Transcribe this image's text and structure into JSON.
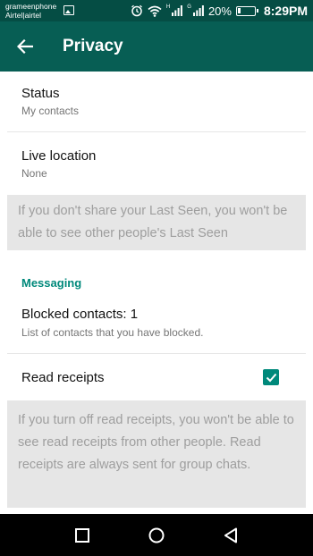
{
  "status_bar": {
    "carrier_1": "grameenphone",
    "carrier_2": "Airtel|airtel",
    "sim1_label": "H",
    "sim2_label": "G",
    "battery_percent": "20%",
    "battery_level": 0.2,
    "time": "8:29PM"
  },
  "app_bar": {
    "title": "Privacy"
  },
  "settings": {
    "status": {
      "title": "Status",
      "value": "My contacts"
    },
    "live_location": {
      "title": "Live location",
      "value": "None"
    },
    "last_seen_note": "If you don't share your Last Seen, you won't be able to see other people's Last Seen",
    "messaging_header": "Messaging",
    "blocked": {
      "title": "Blocked contacts: 1",
      "subtitle": "List of contacts that you have blocked."
    },
    "read_receipts": {
      "title": "Read receipts",
      "checked": true
    },
    "read_receipts_note": "If you turn off read receipts, you won't be able to see read receipts from other people. Read receipts are always sent for group chats."
  },
  "colors": {
    "status_bar": "#054d44",
    "app_bar": "#075e54",
    "accent": "#00897b",
    "info_bg": "#e6e6e6"
  },
  "icons": [
    "gallery-icon",
    "alarm-icon",
    "wifi-icon",
    "signal-icon",
    "battery-icon",
    "back-arrow-icon",
    "check-icon",
    "recents-icon",
    "home-icon",
    "back-icon"
  ]
}
